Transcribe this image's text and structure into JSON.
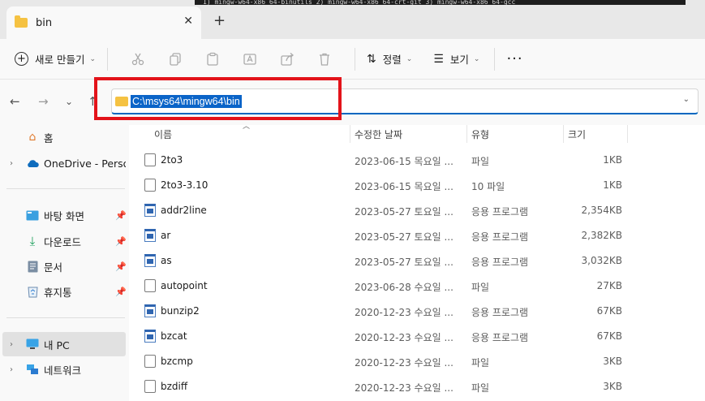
{
  "terminal_snippet": "1) mingw-w64-x86_64-binutils  2) mingw-w64-x86_64-crt-git  3) mingw-w64-x86_64-gcc",
  "tab": {
    "title": "bin",
    "close_glyph": "✕",
    "new_tab_glyph": "+"
  },
  "toolbar": {
    "new_label": "새로 만들기",
    "sort_label": "정렬",
    "view_label": "보기",
    "more_glyph": "···"
  },
  "address": {
    "path": "C:\\msys64\\mingw64\\bin"
  },
  "nav_pane": {
    "home": "홈",
    "onedrive": "OneDrive - Persona",
    "desktop": "바탕 화면",
    "downloads": "다운로드",
    "documents": "문서",
    "recycle": "휴지통",
    "this_pc": "내 PC",
    "network": "네트워크"
  },
  "columns": {
    "name": "이름",
    "date": "수정한 날짜",
    "type": "유형",
    "size": "크기"
  },
  "files": [
    {
      "name": "2to3",
      "date": "2023-06-15 목요일 ...",
      "type": "파일",
      "size": "1KB",
      "kind": "doc"
    },
    {
      "name": "2to3-3.10",
      "date": "2023-06-15 목요일 ...",
      "type": "10 파일",
      "size": "1KB",
      "kind": "doc"
    },
    {
      "name": "addr2line",
      "date": "2023-05-27 토요일 ...",
      "type": "응용 프로그램",
      "size": "2,354KB",
      "kind": "exe"
    },
    {
      "name": "ar",
      "date": "2023-05-27 토요일 ...",
      "type": "응용 프로그램",
      "size": "2,382KB",
      "kind": "exe"
    },
    {
      "name": "as",
      "date": "2023-05-27 토요일 ...",
      "type": "응용 프로그램",
      "size": "3,032KB",
      "kind": "exe"
    },
    {
      "name": "autopoint",
      "date": "2023-06-28 수요일 ...",
      "type": "파일",
      "size": "27KB",
      "kind": "doc"
    },
    {
      "name": "bunzip2",
      "date": "2020-12-23 수요일 ...",
      "type": "응용 프로그램",
      "size": "67KB",
      "kind": "exe"
    },
    {
      "name": "bzcat",
      "date": "2020-12-23 수요일 ...",
      "type": "응용 프로그램",
      "size": "67KB",
      "kind": "exe"
    },
    {
      "name": "bzcmp",
      "date": "2020-12-23 수요일 ...",
      "type": "파일",
      "size": "3KB",
      "kind": "doc"
    },
    {
      "name": "bzdiff",
      "date": "2020-12-23 수요일 ...",
      "type": "파일",
      "size": "3KB",
      "kind": "doc"
    }
  ],
  "colors": {
    "accent": "#0067c0",
    "highlight": "#e3131a",
    "folder": "#f5c242"
  }
}
